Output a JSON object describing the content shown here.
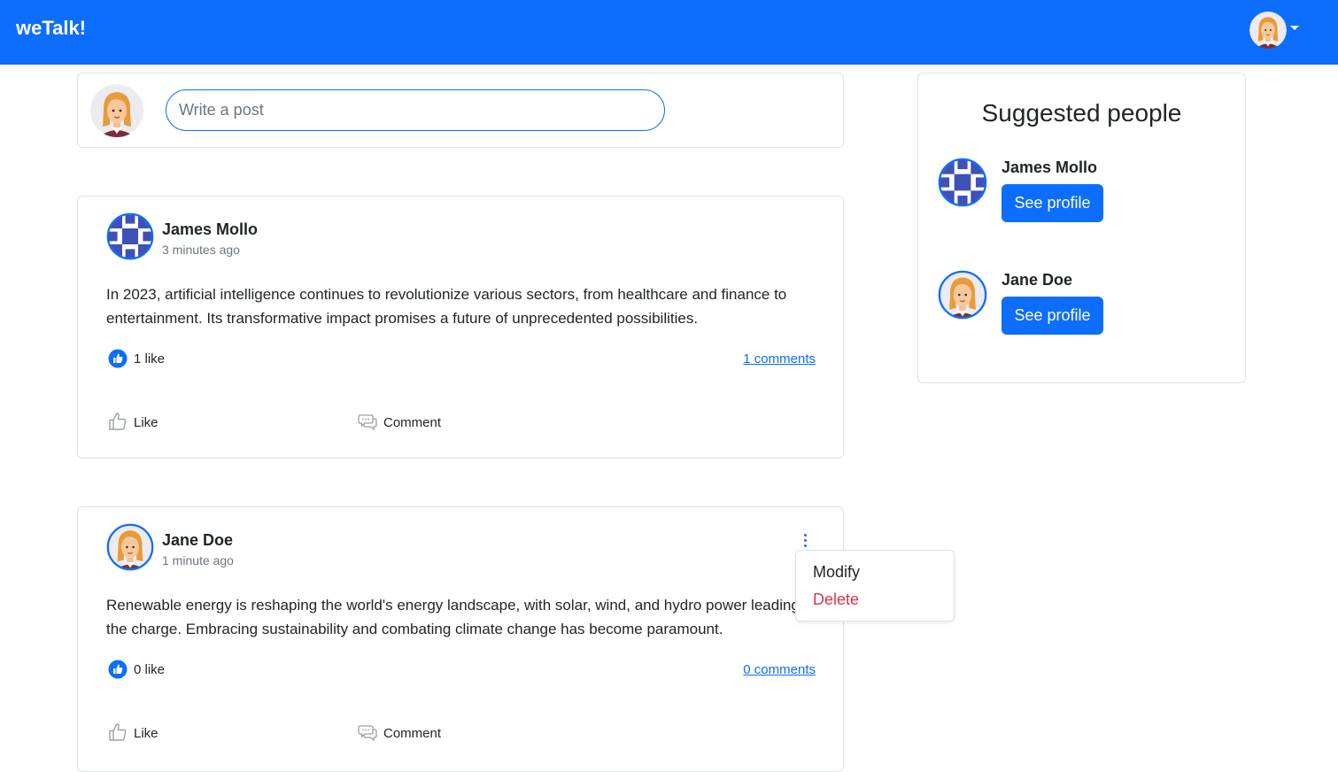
{
  "app": {
    "brand": "weTalk!"
  },
  "header": {
    "avatar_icon": "woman-avatar-icon",
    "menu_icon": "caret-down-icon"
  },
  "composer": {
    "placeholder": "Write a post",
    "avatar_icon": "woman-avatar-icon"
  },
  "posts": [
    {
      "author": "James Mollo",
      "time": "3 minutes ago",
      "body": "In 2023, artificial intelligence continues to revolutionize various sectors, from healthcare and finance to entertainment. Its transformative impact promises a future of unprecedented possibilities.",
      "likes": "1 like",
      "comments": "1 comments",
      "like_label": "Like",
      "comment_label": "Comment",
      "avatar_icon": "pattern-avatar-icon"
    },
    {
      "author": "Jane Doe",
      "time": "1 minute ago",
      "body": "Renewable energy is reshaping the world's energy landscape, with solar, wind, and hydro power leading the charge. Embracing sustainability and combating climate change has become paramount.",
      "likes": "0 like",
      "comments": "0 comments",
      "like_label": "Like",
      "comment_label": "Comment",
      "avatar_icon": "woman-avatar-icon"
    }
  ],
  "post_menu": {
    "modify": "Modify",
    "delete": "Delete"
  },
  "suggested": {
    "title": "Suggested people",
    "people": [
      {
        "name": "James Mollo",
        "button": "See profile",
        "avatar_icon": "pattern-avatar-icon"
      },
      {
        "name": "Jane Doe",
        "button": "See profile",
        "avatar_icon": "woman-avatar-icon"
      }
    ]
  },
  "colors": {
    "primary": "#0d6efd",
    "danger": "#dc3545",
    "muted": "#6c757d",
    "border": "#dfe2e6"
  }
}
